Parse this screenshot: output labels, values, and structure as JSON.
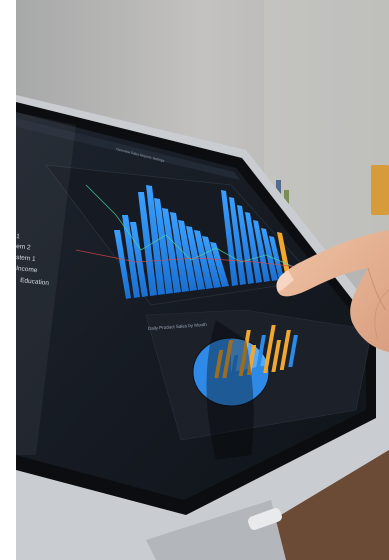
{
  "photo": {
    "subject": "photo",
    "dashboard": {
      "nav_text": "Overview    Sales    Reports    Settings",
      "menu_labels": [
        "1",
        "em 2",
        "stem 1",
        "Income",
        "Education"
      ],
      "panel_title": "Daily Product Sales by Month"
    },
    "colors": {
      "wall": "#b9b8b6",
      "screen": "#14181f",
      "bar_blue": "#2a8be8",
      "bar_orange": "#f0a830",
      "pie_blue": "#2e8ae6",
      "skin": "#eab79a"
    }
  }
}
